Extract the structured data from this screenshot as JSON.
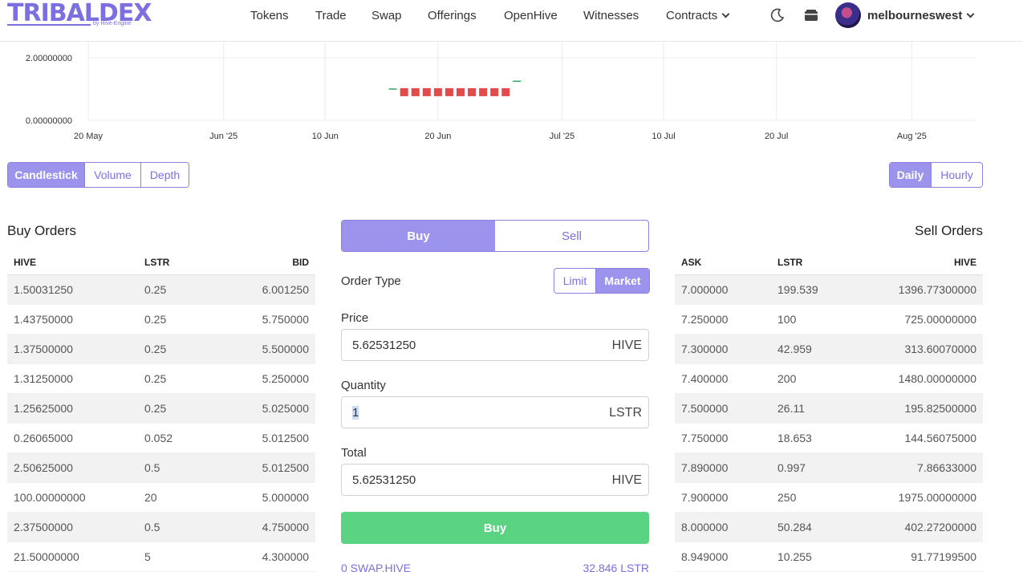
{
  "header": {
    "logo_text": "TRIBALDEX",
    "logo_sub": "by Hive-Engine",
    "nav": [
      {
        "label": "Tokens"
      },
      {
        "label": "Trade"
      },
      {
        "label": "Swap"
      },
      {
        "label": "Offerings"
      },
      {
        "label": "OpenHive"
      },
      {
        "label": "Witnesses"
      },
      {
        "label": "Contracts"
      }
    ],
    "username": "melbourneswest",
    "icons": [
      "moon-icon",
      "wallet-icon",
      "chevron-down-icon"
    ]
  },
  "chart_data": {
    "type": "candlestick",
    "x_ticks": [
      "20 May",
      "Jun '25",
      "10 Jun",
      "20 Jun",
      "Jul '25",
      "10 Jul",
      "20 Jul",
      "Aug '25"
    ],
    "y_ticks": [
      "2.00000000",
      "0.00000000"
    ],
    "ylim": [
      0,
      2
    ],
    "grid": true,
    "candles": [
      {
        "x": "2025-06-16",
        "y": 1.0,
        "color": "#2ea866"
      },
      {
        "x": "2025-06-17",
        "y": 0.9,
        "color": "#e34a4a"
      },
      {
        "x": "2025-06-18",
        "y": 0.9,
        "color": "#e34a4a"
      },
      {
        "x": "2025-06-19",
        "y": 0.9,
        "color": "#e34a4a"
      },
      {
        "x": "2025-06-20",
        "y": 0.9,
        "color": "#e34a4a"
      },
      {
        "x": "2025-06-21",
        "y": 0.9,
        "color": "#e34a4a"
      },
      {
        "x": "2025-06-22",
        "y": 0.9,
        "color": "#e34a4a"
      },
      {
        "x": "2025-06-23",
        "y": 0.9,
        "color": "#e34a4a"
      },
      {
        "x": "2025-06-24",
        "y": 0.9,
        "color": "#e34a4a"
      },
      {
        "x": "2025-06-25",
        "y": 0.9,
        "color": "#e34a4a"
      },
      {
        "x": "2025-06-26",
        "y": 0.9,
        "color": "#e34a4a"
      },
      {
        "x": "2025-06-27",
        "y": 1.25,
        "color": "#2ea866"
      }
    ]
  },
  "chart_controls": {
    "views": [
      "Candlestick",
      "Volume",
      "Depth"
    ],
    "active_view": "Candlestick",
    "intervals": [
      "Daily",
      "Hourly"
    ],
    "active_interval": "Daily"
  },
  "buy_orders": {
    "title": "Buy Orders",
    "columns": [
      "HIVE",
      "LSTR",
      "BID"
    ],
    "rows": [
      [
        "1.50031250",
        "0.25",
        "6.001250"
      ],
      [
        "1.43750000",
        "0.25",
        "5.750000"
      ],
      [
        "1.37500000",
        "0.25",
        "5.500000"
      ],
      [
        "1.31250000",
        "0.25",
        "5.250000"
      ],
      [
        "1.25625000",
        "0.25",
        "5.025000"
      ],
      [
        "0.26065000",
        "0.052",
        "5.012500"
      ],
      [
        "2.50625000",
        "0.5",
        "5.012500"
      ],
      [
        "100.00000000",
        "20",
        "5.000000"
      ],
      [
        "2.37500000",
        "0.5",
        "4.750000"
      ],
      [
        "21.50000000",
        "5",
        "4.300000"
      ]
    ]
  },
  "sell_orders": {
    "title": "Sell Orders",
    "columns": [
      "ASK",
      "LSTR",
      "HIVE"
    ],
    "rows": [
      [
        "7.000000",
        "199.539",
        "1396.77300000"
      ],
      [
        "7.250000",
        "100",
        "725.00000000"
      ],
      [
        "7.300000",
        "42.959",
        "313.60070000"
      ],
      [
        "7.400000",
        "200",
        "1480.00000000"
      ],
      [
        "7.500000",
        "26.11",
        "195.82500000"
      ],
      [
        "7.750000",
        "18.653",
        "144.56075000"
      ],
      [
        "7.890000",
        "0.997",
        "7.86633000"
      ],
      [
        "7.900000",
        "250",
        "1975.00000000"
      ],
      [
        "8.000000",
        "50.284",
        "402.27200000"
      ],
      [
        "8.949000",
        "10.255",
        "91.77199500"
      ]
    ]
  },
  "order_form": {
    "tabs": [
      "Buy",
      "Sell"
    ],
    "active_tab": "Buy",
    "order_type_label": "Order Type",
    "order_types": [
      "Limit",
      "Market"
    ],
    "active_order_type": "Market",
    "price_label": "Price",
    "price_value": "5.62531250",
    "price_unit": "HIVE",
    "quantity_label": "Quantity",
    "quantity_value": "1",
    "quantity_unit": "LSTR",
    "total_label": "Total",
    "total_value": "5.62531250",
    "total_unit": "HIVE",
    "submit_label": "Buy",
    "balance_left": "0 SWAP.HIVE",
    "balance_right": "32.846 LSTR"
  }
}
